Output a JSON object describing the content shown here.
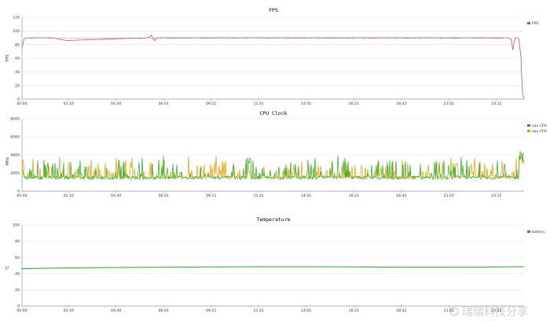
{
  "chart_data": [
    {
      "type": "line",
      "title": "FPS",
      "ylabel": "FPS",
      "ylim": [
        0,
        120
      ],
      "yticks": [
        0,
        20,
        40,
        60,
        80,
        100,
        120
      ],
      "xlabels": [
        "00:00",
        "02:10",
        "04:40",
        "06:01",
        "09:21",
        "11:41",
        "14:01",
        "16:21",
        "18:42",
        "21:02",
        "23:22"
      ],
      "grid": true,
      "legend": "top-right",
      "series": [
        {
          "name": "FPS",
          "color": "#c0506a",
          "x": [
            0,
            3,
            8,
            40,
            60,
            165,
            170,
            172,
            174,
            176,
            180,
            400,
            600,
            645,
            650,
            652,
            655,
            658,
            660,
            663,
            664,
            665,
            667
          ],
          "values": [
            76,
            89,
            90,
            90,
            86,
            90,
            91,
            94,
            89,
            86,
            90,
            90,
            90,
            90,
            88,
            72,
            90,
            90,
            88,
            60,
            30,
            8,
            0
          ]
        }
      ]
    },
    {
      "type": "line",
      "title": "CPU Clock",
      "ylabel": "MHz",
      "ylim": [
        0,
        8000
      ],
      "yticks": [
        0,
        2000,
        4000,
        6000,
        8000
      ],
      "xlabels": [
        "00:00",
        "02:10",
        "04:40",
        "06:01",
        "09:21",
        "11:41",
        "14:01",
        "16:21",
        "18:42",
        "21:02",
        "23:22"
      ],
      "grid": true,
      "legend": "top-right",
      "series": [
        {
          "name": "cpu CPU",
          "color": "#22aa22"
        },
        {
          "name": "cpu CPU",
          "color": "#e0a000"
        }
      ]
    },
    {
      "type": "line",
      "title": "Temperature",
      "ylabel": "°C",
      "ylim": [
        0,
        100
      ],
      "yticks": [
        0,
        20,
        40,
        60,
        80,
        100
      ],
      "xlabels": [
        "00:00",
        "02:10",
        "04:40",
        "06:01",
        "09:21",
        "11:41",
        "14:01",
        "16:21",
        "18:42",
        "21:02",
        "23:22"
      ],
      "grid": true,
      "legend": "top-right",
      "series": [
        {
          "name": "battery",
          "color": "#22aa22",
          "x": [
            0,
            50,
            100,
            200,
            320,
            400,
            500,
            600,
            667
          ],
          "values": [
            46,
            47,
            47.5,
            48,
            48.5,
            48.5,
            48,
            48,
            48.5
          ]
        }
      ]
    }
  ],
  "watermark": "瑞瑞科技分享"
}
